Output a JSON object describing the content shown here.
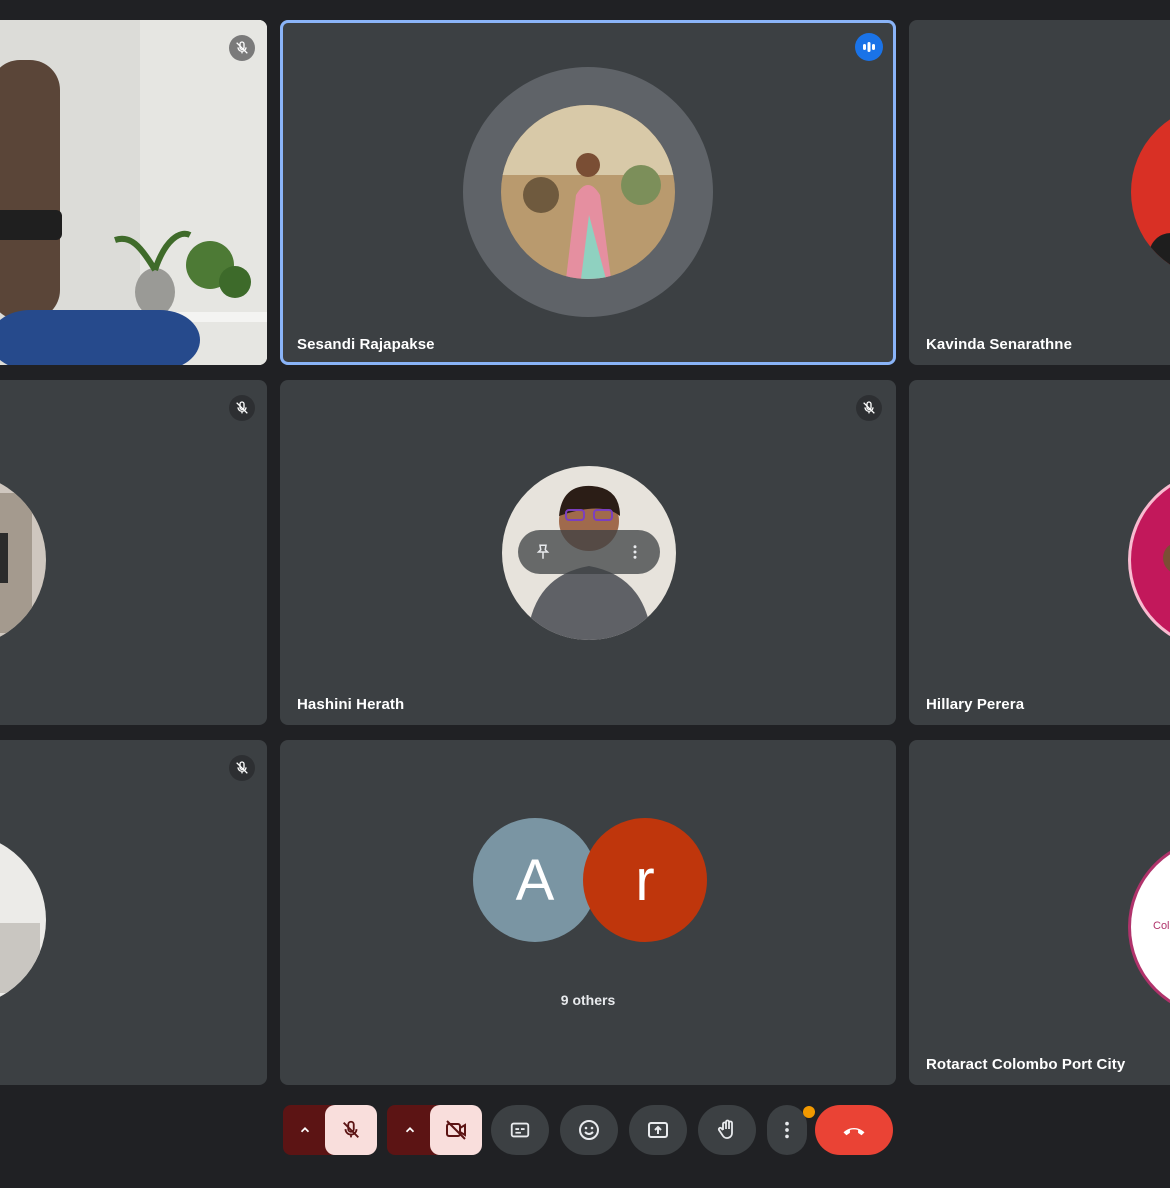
{
  "participants": {
    "p1": {
      "name": "",
      "muted": true
    },
    "p2": {
      "name": "Sesandi Rajapakse",
      "speaking": true
    },
    "p3": {
      "name": "Kavinda Senarathne"
    },
    "p4": {
      "name": "",
      "muted": true
    },
    "p5": {
      "name": "Hashini Herath",
      "muted": true
    },
    "p6": {
      "name": "Hillary Perera"
    },
    "p7": {
      "name": "",
      "muted": true
    },
    "p8": {
      "others_label": "9 others",
      "initials": [
        "A",
        "r"
      ]
    },
    "p9": {
      "name": "Rotaract Colombo Port City",
      "avatar_text": "Col"
    }
  },
  "controls": {
    "mic_state": "muted",
    "camera_state": "off",
    "buttons": [
      "captions-icon",
      "emoji-icon",
      "present-icon",
      "raise-hand-icon",
      "more-icon",
      "end-call-icon"
    ]
  },
  "colors": {
    "background": "#202124",
    "tile": "#3c4043",
    "active_border": "#8ab4f8",
    "end_call": "#ea4335",
    "avatar_a": "#7a95a3",
    "avatar_r": "#bf360c"
  }
}
